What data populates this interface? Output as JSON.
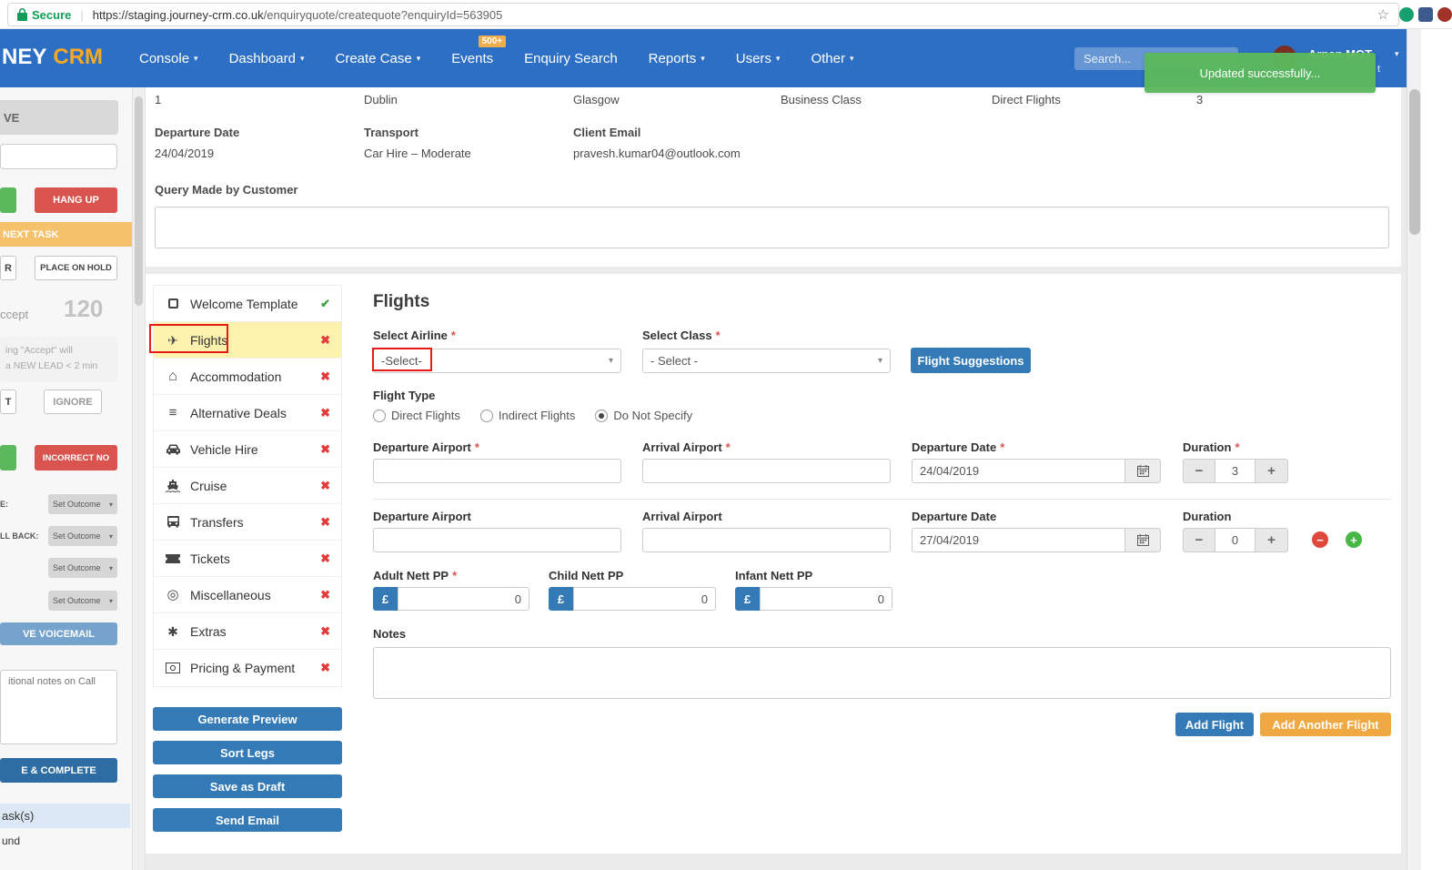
{
  "browser": {
    "secure_label": "Secure",
    "url_host": "https://staging.journey-crm.co.uk",
    "url_path": "/enquiryquote/createquote?enquiryId=563905"
  },
  "icon_glyphs": {
    "caret": "▾",
    "star": "☆",
    "check": "✔",
    "cross": "✖",
    "plane": "✈",
    "home": "⌂",
    "list": "≡",
    "target": "◎",
    "asterisk": "✱",
    "minus": "−",
    "plus": "+",
    "sep": "|",
    "required": "*"
  },
  "navbar": {
    "brand_prefix": "NEY",
    "brand_suffix": "CRM",
    "items": [
      {
        "label": "Console"
      },
      {
        "label": "Dashboard"
      },
      {
        "label": "Create Case"
      },
      {
        "label": "Events"
      },
      {
        "label": "Enquiry Search"
      },
      {
        "label": "Reports"
      },
      {
        "label": "Users"
      },
      {
        "label": "Other"
      }
    ],
    "events_badge": "500+",
    "search_placeholder": "Search...",
    "user_name": "Arpan MOT",
    "user_fragment": "t",
    "toast_message": "Updated successfully..."
  },
  "sidebar": {
    "tab_fragment": "VE",
    "hang_up": "HANG UP",
    "next_task": "NEXT TASK",
    "hold_fragment": "R",
    "place_on_hold": "PLACE ON HOLD",
    "accept_fragment": "ccept",
    "timer": "120",
    "hint_line1": "ing \"Accept\" will",
    "hint_line2": "a NEW LEAD < 2 min",
    "ignore_fragment": "T",
    "ignore": "IGNORE",
    "incorrect_no": "INCORRECT NO",
    "outcome_rows": [
      {
        "label": "E:",
        "value": "Set Outcome"
      },
      {
        "label": "LL BACK:",
        "value": "Set Outcome"
      },
      {
        "label": "",
        "value": "Set Outcome"
      },
      {
        "label": "",
        "value": "Set Outcome"
      }
    ],
    "voicemail": "VE VOICEMAIL",
    "notes_placeholder": "itional notes on Call",
    "complete": "E & COMPLETE",
    "tasks_fragment": "ask(s)",
    "bottom_fragment": "und"
  },
  "summary": {
    "row_values": [
      "1",
      "Dublin",
      "Glasgow",
      "Business Class",
      "Direct Flights",
      "3"
    ],
    "fields": [
      {
        "label": "Departure Date",
        "value": "24/04/2019"
      },
      {
        "label": "Transport",
        "value": "Car Hire – Moderate"
      },
      {
        "label": "Client Email",
        "value": "pravesh.kumar04@outlook.com"
      }
    ],
    "query_label": "Query Made by Customer"
  },
  "quote_tabs": {
    "items": [
      {
        "label": "Welcome Template"
      },
      {
        "label": "Flights"
      },
      {
        "label": "Accommodation"
      },
      {
        "label": "Alternative Deals"
      },
      {
        "label": "Vehicle Hire"
      },
      {
        "label": "Cruise"
      },
      {
        "label": "Transfers"
      },
      {
        "label": "Tickets"
      },
      {
        "label": "Miscellaneous"
      },
      {
        "label": "Extras"
      },
      {
        "label": "Pricing & Payment"
      }
    ],
    "buttons": [
      "Generate Preview",
      "Sort Legs",
      "Save as Draft",
      "Send Email"
    ]
  },
  "flights": {
    "title": "Flights",
    "airline_label": "Select Airline",
    "airline_value": "-Select-",
    "class_label": "Select Class",
    "class_value": "- Select -",
    "suggestions_button": "Flight Suggestions",
    "flight_type_label": "Flight Type",
    "flight_type_options": [
      {
        "label": "Direct Flights"
      },
      {
        "label": "Indirect Flights"
      },
      {
        "label": "Do Not Specify"
      }
    ],
    "selected_flight_type": "Do Not Specify",
    "leg_labels": {
      "departure_airport": "Departure Airport",
      "arrival_airport": "Arrival Airport",
      "departure_date": "Departure Date",
      "duration": "Duration"
    },
    "legs": [
      {
        "departure_airport": "",
        "arrival_airport": "",
        "date": "24/04/2019",
        "duration": "3"
      },
      {
        "departure_airport": "",
        "arrival_airport": "",
        "date": "27/04/2019",
        "duration": "0"
      }
    ],
    "nett_fields": [
      {
        "label": "Adult Nett PP",
        "currency": "£",
        "value": "0"
      },
      {
        "label": "Child Nett PP",
        "currency": "£",
        "value": "0"
      },
      {
        "label": "Infant Nett PP",
        "currency": "£",
        "value": "0"
      }
    ],
    "notes_label": "Notes",
    "add_flight": "Add Flight",
    "add_another_flight": "Add Another Flight"
  }
}
